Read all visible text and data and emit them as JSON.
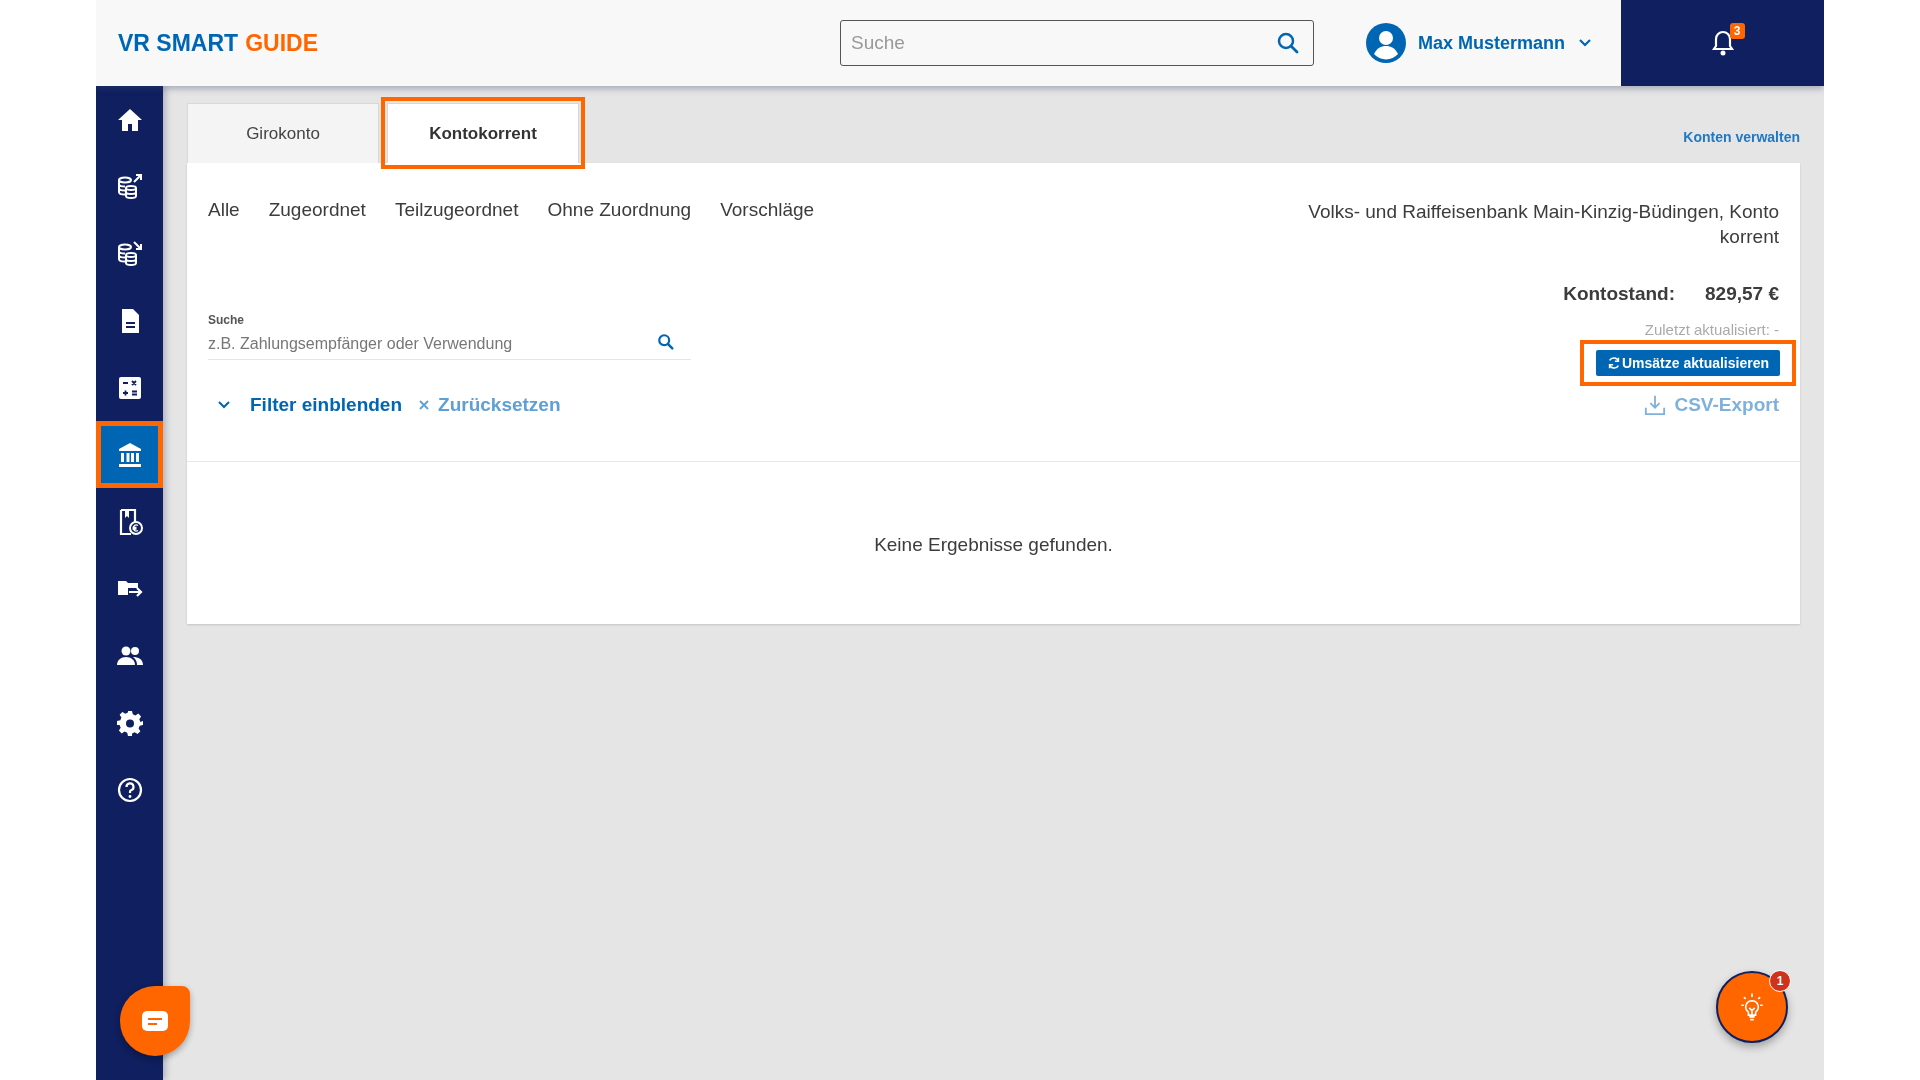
{
  "header": {
    "logo": {
      "part_1": "VR SMART",
      "part_2": "GUIDE"
    },
    "search": {
      "placeholder": "Suche"
    },
    "user": {
      "name": "Max Mustermann"
    },
    "notifications": {
      "badge": "3"
    }
  },
  "sidebar": {
    "items": [
      {
        "kind": "home",
        "selected": false,
        "highlighted": false
      },
      {
        "kind": "coins-out",
        "selected": false,
        "highlighted": false
      },
      {
        "kind": "coins-in",
        "selected": false,
        "highlighted": false
      },
      {
        "kind": "document",
        "selected": false,
        "highlighted": false
      },
      {
        "kind": "calculator",
        "selected": false,
        "highlighted": false
      },
      {
        "kind": "bank",
        "selected": true,
        "highlighted": true
      },
      {
        "kind": "receipt",
        "selected": false,
        "highlighted": false
      },
      {
        "kind": "folder",
        "selected": false,
        "highlighted": false
      },
      {
        "kind": "people",
        "selected": false,
        "highlighted": false
      },
      {
        "kind": "settings",
        "selected": false,
        "highlighted": false
      },
      {
        "kind": "help",
        "selected": false,
        "highlighted": false
      }
    ]
  },
  "tabs": [
    {
      "label": "Girokonto",
      "selected": false,
      "highlighted": false
    },
    {
      "label": "Kontokorrent",
      "selected": true,
      "highlighted": true
    }
  ],
  "manage_link": "Konten verwalten",
  "filters": [
    "Alle",
    "Zugeordnet",
    "Teilzugeordnet",
    "Ohne Zuordnung",
    "Vorschläge"
  ],
  "account_name": "Volks- und Raiffeisenbank Main-Kinzig-Büdingen, Kontokorrent",
  "search": {
    "label": "Suche",
    "placeholder": "z.B. Zahlungsempfänger oder Verwendung"
  },
  "filter_toggle": "Filter einblenden",
  "reset": "Zurücksetzen",
  "balance": {
    "label": "Kontostand:",
    "value": "829,57 €"
  },
  "last_updated": "Zuletzt aktualisiert: -",
  "refresh_button": {
    "label": "Umsätze aktualisieren",
    "highlighted": true
  },
  "csv_export": "CSV-Export",
  "empty_message": "Keine Ergebnisse gefunden.",
  "help_fab": {
    "badge": "1"
  }
}
